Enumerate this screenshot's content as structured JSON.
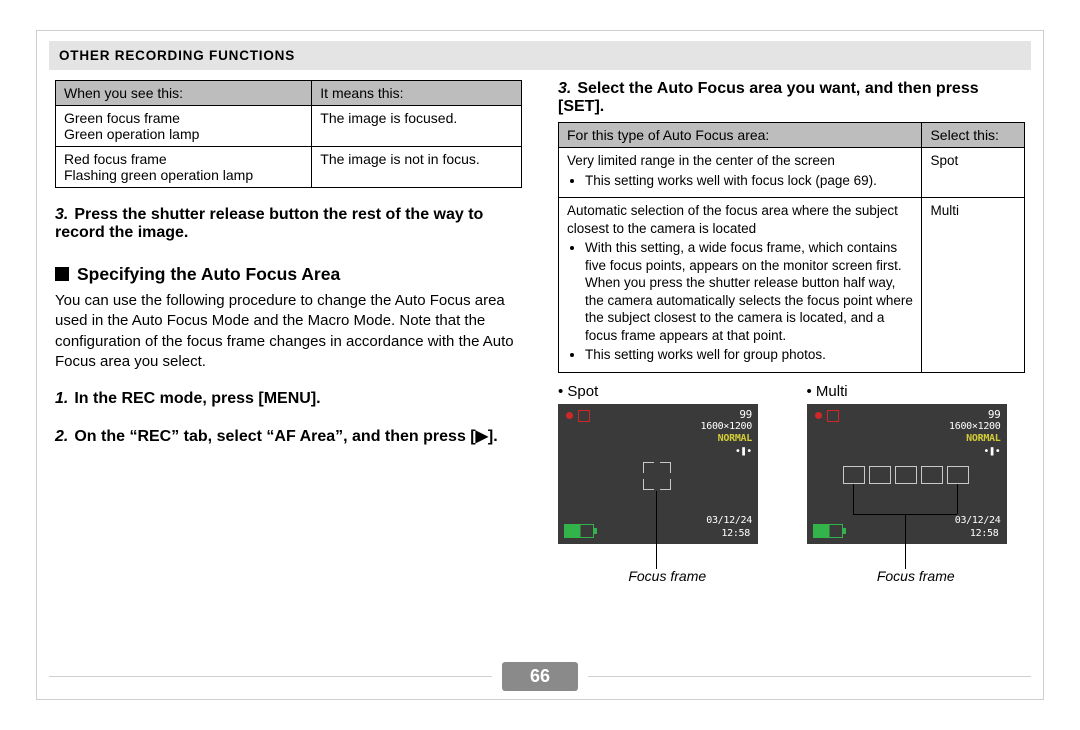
{
  "header": {
    "section_title": "OTHER RECORDING FUNCTIONS"
  },
  "left": {
    "focus_table": {
      "headers": [
        "When you see this:",
        "It means this:"
      ],
      "rows": [
        {
          "see": "Green focus frame\nGreen operation lamp",
          "means": "The image is focused."
        },
        {
          "see": "Red focus frame\nFlashing green operation lamp",
          "means": "The image is not in focus."
        }
      ]
    },
    "step3": {
      "num": "3.",
      "text": "Press the shutter release button the rest of the way to record the image."
    },
    "section": {
      "title": "Specifying the Auto Focus Area"
    },
    "intro": "You can use the following procedure to change the Auto Focus area used in the Auto Focus Mode and the Macro Mode. Note that the configuration of the focus frame changes in accordance with the Auto Focus area you select.",
    "step1": {
      "num": "1.",
      "text": "In the REC mode, press [MENU]."
    },
    "step2": {
      "num": "2.",
      "text": "On the “REC” tab, select “AF Area”, and then press [▶]."
    }
  },
  "right": {
    "step3": {
      "num": "3.",
      "text": "Select the Auto Focus area you want, and then press [SET]."
    },
    "af_table": {
      "headers": [
        "For this type of Auto Focus area:",
        "Select this:"
      ],
      "rows": [
        {
          "desc": "Very limited range in the center of the screen",
          "bullets": [
            "This setting works well with focus lock (page 69)."
          ],
          "select": "Spot"
        },
        {
          "desc": "Automatic selection of the focus area where the subject closest to the camera is located",
          "bullets": [
            "With this setting, a wide focus frame, which contains five focus points, appears on the monitor screen first.  When you press the shutter release button half way, the camera automatically selects the focus point where the subject closest to the camera is located, and a focus frame appears at that point.",
            "This setting works well for group photos."
          ],
          "select": "Multi"
        }
      ]
    },
    "examples": {
      "spot_label": "Spot",
      "multi_label": "Multi",
      "screen": {
        "num99": "99",
        "res": "1600×1200",
        "normal": "NORMAL",
        "mem": "•❚•",
        "date": "03/12/24",
        "time": "12:58"
      },
      "caption": "Focus frame"
    }
  },
  "footer": {
    "page": "66"
  }
}
